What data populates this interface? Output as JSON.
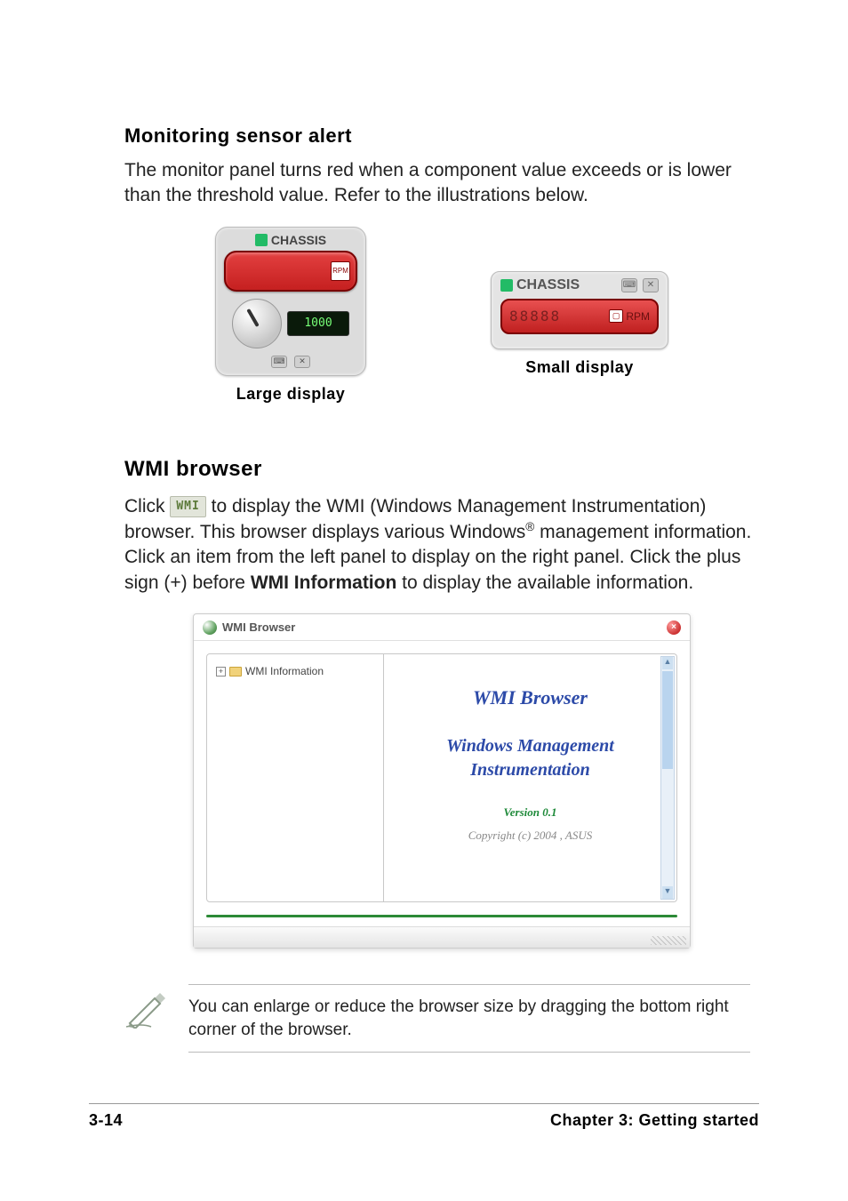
{
  "headings": {
    "monitoring": "Monitoring sensor alert",
    "wmi": "WMI browser"
  },
  "paragraphs": {
    "monitoring": "The monitor panel turns red when a component value exceeds or is lower than the threshold value. Refer to the illustrations below.",
    "wmi_a": "Click ",
    "wmi_icon": "WMI",
    "wmi_b": " to display the WMI (Windows Management Instrumentation) browser. This browser displays various Windows",
    "wmi_reg": "®",
    "wmi_c": " management information. Click an item from the left panel to display on the right panel. Click the plus sign (+) before ",
    "wmi_bold": "WMI Information",
    "wmi_d": " to display the available information."
  },
  "sensor": {
    "label": "CHASSIS",
    "rpm_short": "RPM",
    "lcd": "1000",
    "digits": "88888",
    "rpm_text": "RPM"
  },
  "captions": {
    "large": "Large display",
    "small": "Small display"
  },
  "wmi_window": {
    "title": "WMI Browser",
    "tree_item": "WMI Information",
    "right_title": "WMI  Browser",
    "right_sub1": "Windows Management",
    "right_sub2": "Instrumentation",
    "version": "Version  0.1",
    "copyright": "Copyright (c) 2004 ,   ASUS"
  },
  "note": "You can enlarge or reduce the browser size by dragging the bottom right corner of the browser.",
  "footer": {
    "left": "3-14",
    "right": "Chapter 3: Getting started"
  }
}
